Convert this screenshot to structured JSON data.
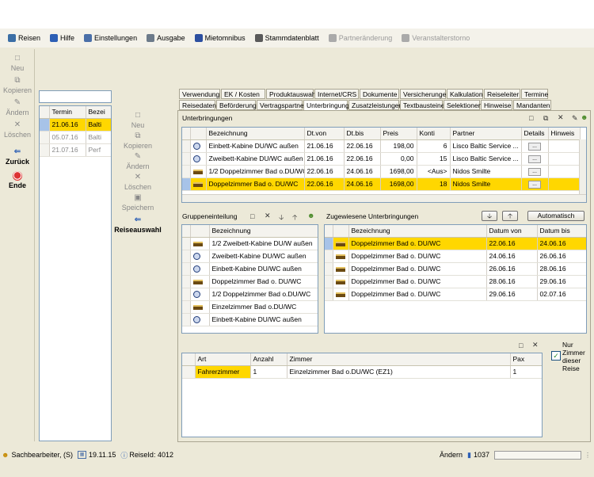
{
  "menu": {
    "items": [
      {
        "label": "Reisen",
        "icon": "travel-icon",
        "color": "#3b6ea5",
        "disabled": false
      },
      {
        "label": "Hilfe",
        "icon": "help-icon",
        "color": "#2d5fb5",
        "disabled": false
      },
      {
        "label": "Einstellungen",
        "icon": "settings-icon",
        "color": "#4a6fa8",
        "disabled": false
      },
      {
        "label": "Ausgabe",
        "icon": "printer-icon",
        "color": "#6c7a8a",
        "disabled": false
      },
      {
        "label": "Mietomnibus",
        "icon": "bus-icon",
        "color": "#2c4fa0",
        "disabled": false
      },
      {
        "label": "Stammdatenblatt",
        "icon": "document-icon",
        "color": "#5a5a5a",
        "disabled": false
      },
      {
        "label": "Partneränderung",
        "icon": "partner-icon",
        "color": "#aaaaaa",
        "disabled": true
      },
      {
        "label": "Veranstalterstorno",
        "icon": "cancel-icon",
        "color": "#aaaaaa",
        "disabled": true
      }
    ]
  },
  "leftbar": {
    "neu": "Neu",
    "kopieren": "Kopieren",
    "aendern": "Ändern",
    "loeschen": "Löschen",
    "zurueck": "Zurück",
    "ende": "Ende"
  },
  "termin_list": {
    "headers": [
      "Termin",
      "Bezei"
    ],
    "rows": [
      {
        "termin": "21.06.16",
        "bez": "Balti",
        "selected": true
      },
      {
        "termin": "05.07.16",
        "bez": "Balti",
        "selected": false
      },
      {
        "termin": "21.07.16",
        "bez": "Perf",
        "selected": false
      }
    ]
  },
  "midbar": {
    "neu": "Neu",
    "kopieren": "Kopieren",
    "aendern": "Ändern",
    "loeschen": "Löschen",
    "speichern": "Speichern",
    "reiseauswahl": "Reiseauswahl"
  },
  "tabs": {
    "row1": [
      "Verwendung",
      "EK / Kosten",
      "Produktauswahl",
      "Internet/CRS",
      "Dokumente",
      "Versicherungen",
      "Kalkulation",
      "Reiseleiter",
      "Termine"
    ],
    "row2": [
      "Reisedaten",
      "Beförderung",
      "Vertragspartner",
      "Unterbringung",
      "Zusatzleistungen",
      "Textbausteine",
      "Selektionen",
      "Hinweise",
      "Mandanten"
    ],
    "active": "Unterbringung"
  },
  "unterbringungen": {
    "label": "Unterbringungen",
    "headers": [
      "Bezeichnung",
      "Dt.von",
      "Dt.bis",
      "Preis",
      "Konti",
      "Partner",
      "Details",
      "Hinweis"
    ],
    "rows": [
      {
        "icon": "room",
        "bez": "Einbett-Kabine DU/WC außen",
        "von": "21.06.16",
        "bis": "22.06.16",
        "preis": "198,00",
        "konti": "6",
        "partner": "Lisco Baltic Service ...",
        "details": "...",
        "selected": false
      },
      {
        "icon": "room",
        "bez": "Zweibett-Kabine DU/WC außen",
        "von": "21.06.16",
        "bis": "22.06.16",
        "preis": "0,00",
        "konti": "15",
        "partner": "Lisco Baltic Service ...",
        "details": "...",
        "selected": false
      },
      {
        "icon": "bed",
        "bez": "1/2 Doppelzimmer Bad o.DU/WC",
        "von": "22.06.16",
        "bis": "24.06.16",
        "preis": "1698,00",
        "konti": "<Aus>",
        "partner": "Nidos Smilte",
        "details": "...",
        "selected": false
      },
      {
        "icon": "bed",
        "bez": "Doppelzimmer Bad o. DU/WC",
        "von": "22.06.16",
        "bis": "24.06.16",
        "preis": "1698,00",
        "konti": "18",
        "partner": "Nidos Smilte",
        "details": "...",
        "selected": true
      }
    ]
  },
  "gruppen": {
    "label": "Gruppeneinteilung",
    "header": "Bezeichnung",
    "rows": [
      {
        "icon": "bed",
        "bez": "1/2 Zweibett-Kabine DU/W außen"
      },
      {
        "icon": "room",
        "bez": "Zweibett-Kabine DU/WC außen"
      },
      {
        "icon": "room",
        "bez": "Einbett-Kabine DU/WC außen"
      },
      {
        "icon": "bed",
        "bez": "Doppelzimmer Bad o. DU/WC"
      },
      {
        "icon": "room",
        "bez": "1/2 Doppelzimmer Bad o.DU/WC"
      },
      {
        "icon": "bed",
        "bez": "Einzelzimmer Bad o.DU/WC"
      },
      {
        "icon": "room",
        "bez": "Einbett-Kabine DU/WC außen"
      }
    ]
  },
  "zugewiesen": {
    "label": "Zugewiesene Unterbringungen",
    "automatisch": "Automatisch",
    "headers": [
      "Bezeichnung",
      "Datum von",
      "Datum bis"
    ],
    "rows": [
      {
        "bez": "Doppelzimmer Bad o. DU/WC",
        "von": "22.06.16",
        "bis": "24.06.16",
        "selected": true
      },
      {
        "bez": "Doppelzimmer Bad o. DU/WC",
        "von": "24.06.16",
        "bis": "26.06.16",
        "selected": false
      },
      {
        "bez": "Doppelzimmer Bad o. DU/WC",
        "von": "26.06.16",
        "bis": "28.06.16",
        "selected": false
      },
      {
        "bez": "Doppelzimmer Bad o. DU/WC",
        "von": "28.06.16",
        "bis": "29.06.16",
        "selected": false
      },
      {
        "bez": "Doppelzimmer Bad o. DU/WC",
        "von": "29.06.16",
        "bis": "02.07.16",
        "selected": false
      }
    ]
  },
  "zimmer_table": {
    "headers": [
      "Art",
      "Anzahl",
      "Zimmer",
      "Pax"
    ],
    "rows": [
      {
        "art": "Fahrerzimmer",
        "anzahl": "1",
        "zimmer": "Einzelzimmer Bad o.DU/WC (EZ1)",
        "pax": "1"
      }
    ]
  },
  "nur_zimmer": "Nur Zimmer dieser Reise",
  "status": {
    "user": "Sachbearbeiter, (S)",
    "date": "19.11.15",
    "reise": "ReiseId: 4012",
    "mode": "Ändern",
    "num": "1037"
  }
}
